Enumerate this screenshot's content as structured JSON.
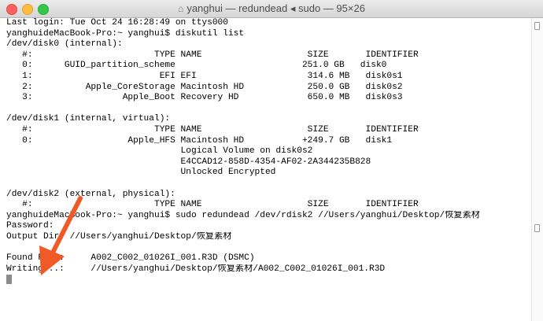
{
  "window": {
    "title": "yanghui — redundead ◂ sudo — 95×26"
  },
  "terminal": {
    "lines": [
      "Last login: Tue Oct 24 16:28:49 on ttys000",
      "yanghuideMacBook-Pro:~ yanghui$ diskutil list",
      "/dev/disk0 (internal):",
      "   #:                       TYPE NAME                    SIZE       IDENTIFIER",
      "   0:      GUID_partition_scheme                        251.0 GB   disk0",
      "   1:                        EFI EFI                     314.6 MB   disk0s1",
      "   2:          Apple_CoreStorage Macintosh HD            250.0 GB   disk0s2",
      "   3:                 Apple_Boot Recovery HD             650.0 MB   disk0s3",
      "",
      "/dev/disk1 (internal, virtual):",
      "   #:                       TYPE NAME                    SIZE       IDENTIFIER",
      "   0:                  Apple_HFS Macintosh HD           +249.7 GB   disk1",
      "                                 Logical Volume on disk0s2",
      "                                 E4CCAD12-858D-4354-AF02-2A344235B828",
      "                                 Unlocked Encrypted",
      "",
      "/dev/disk2 (external, physical):",
      "   #:                       TYPE NAME                    SIZE       IDENTIFIER",
      "yanghuideMacBook-Pro:~ yanghui$ sudo redundead /dev/rdisk2 //Users/yanghui/Desktop/恢复素材",
      "Password:",
      "Output Dir: //Users/yanghui/Desktop/恢复素材",
      "",
      "Found File:     A002_C002_01026I_001.R3D (DSMC)",
      "Writing...:     //Users/yanghui/Desktop/恢复素材/A002_C002_01026I_001.R3D"
    ]
  },
  "icons": {
    "home": "home-icon",
    "arrow": "red-arrow-annotation"
  },
  "colors": {
    "arrow": "#f05a28",
    "close": "#fc605c",
    "minimize": "#fdbc40",
    "zoom": "#34c84a"
  }
}
